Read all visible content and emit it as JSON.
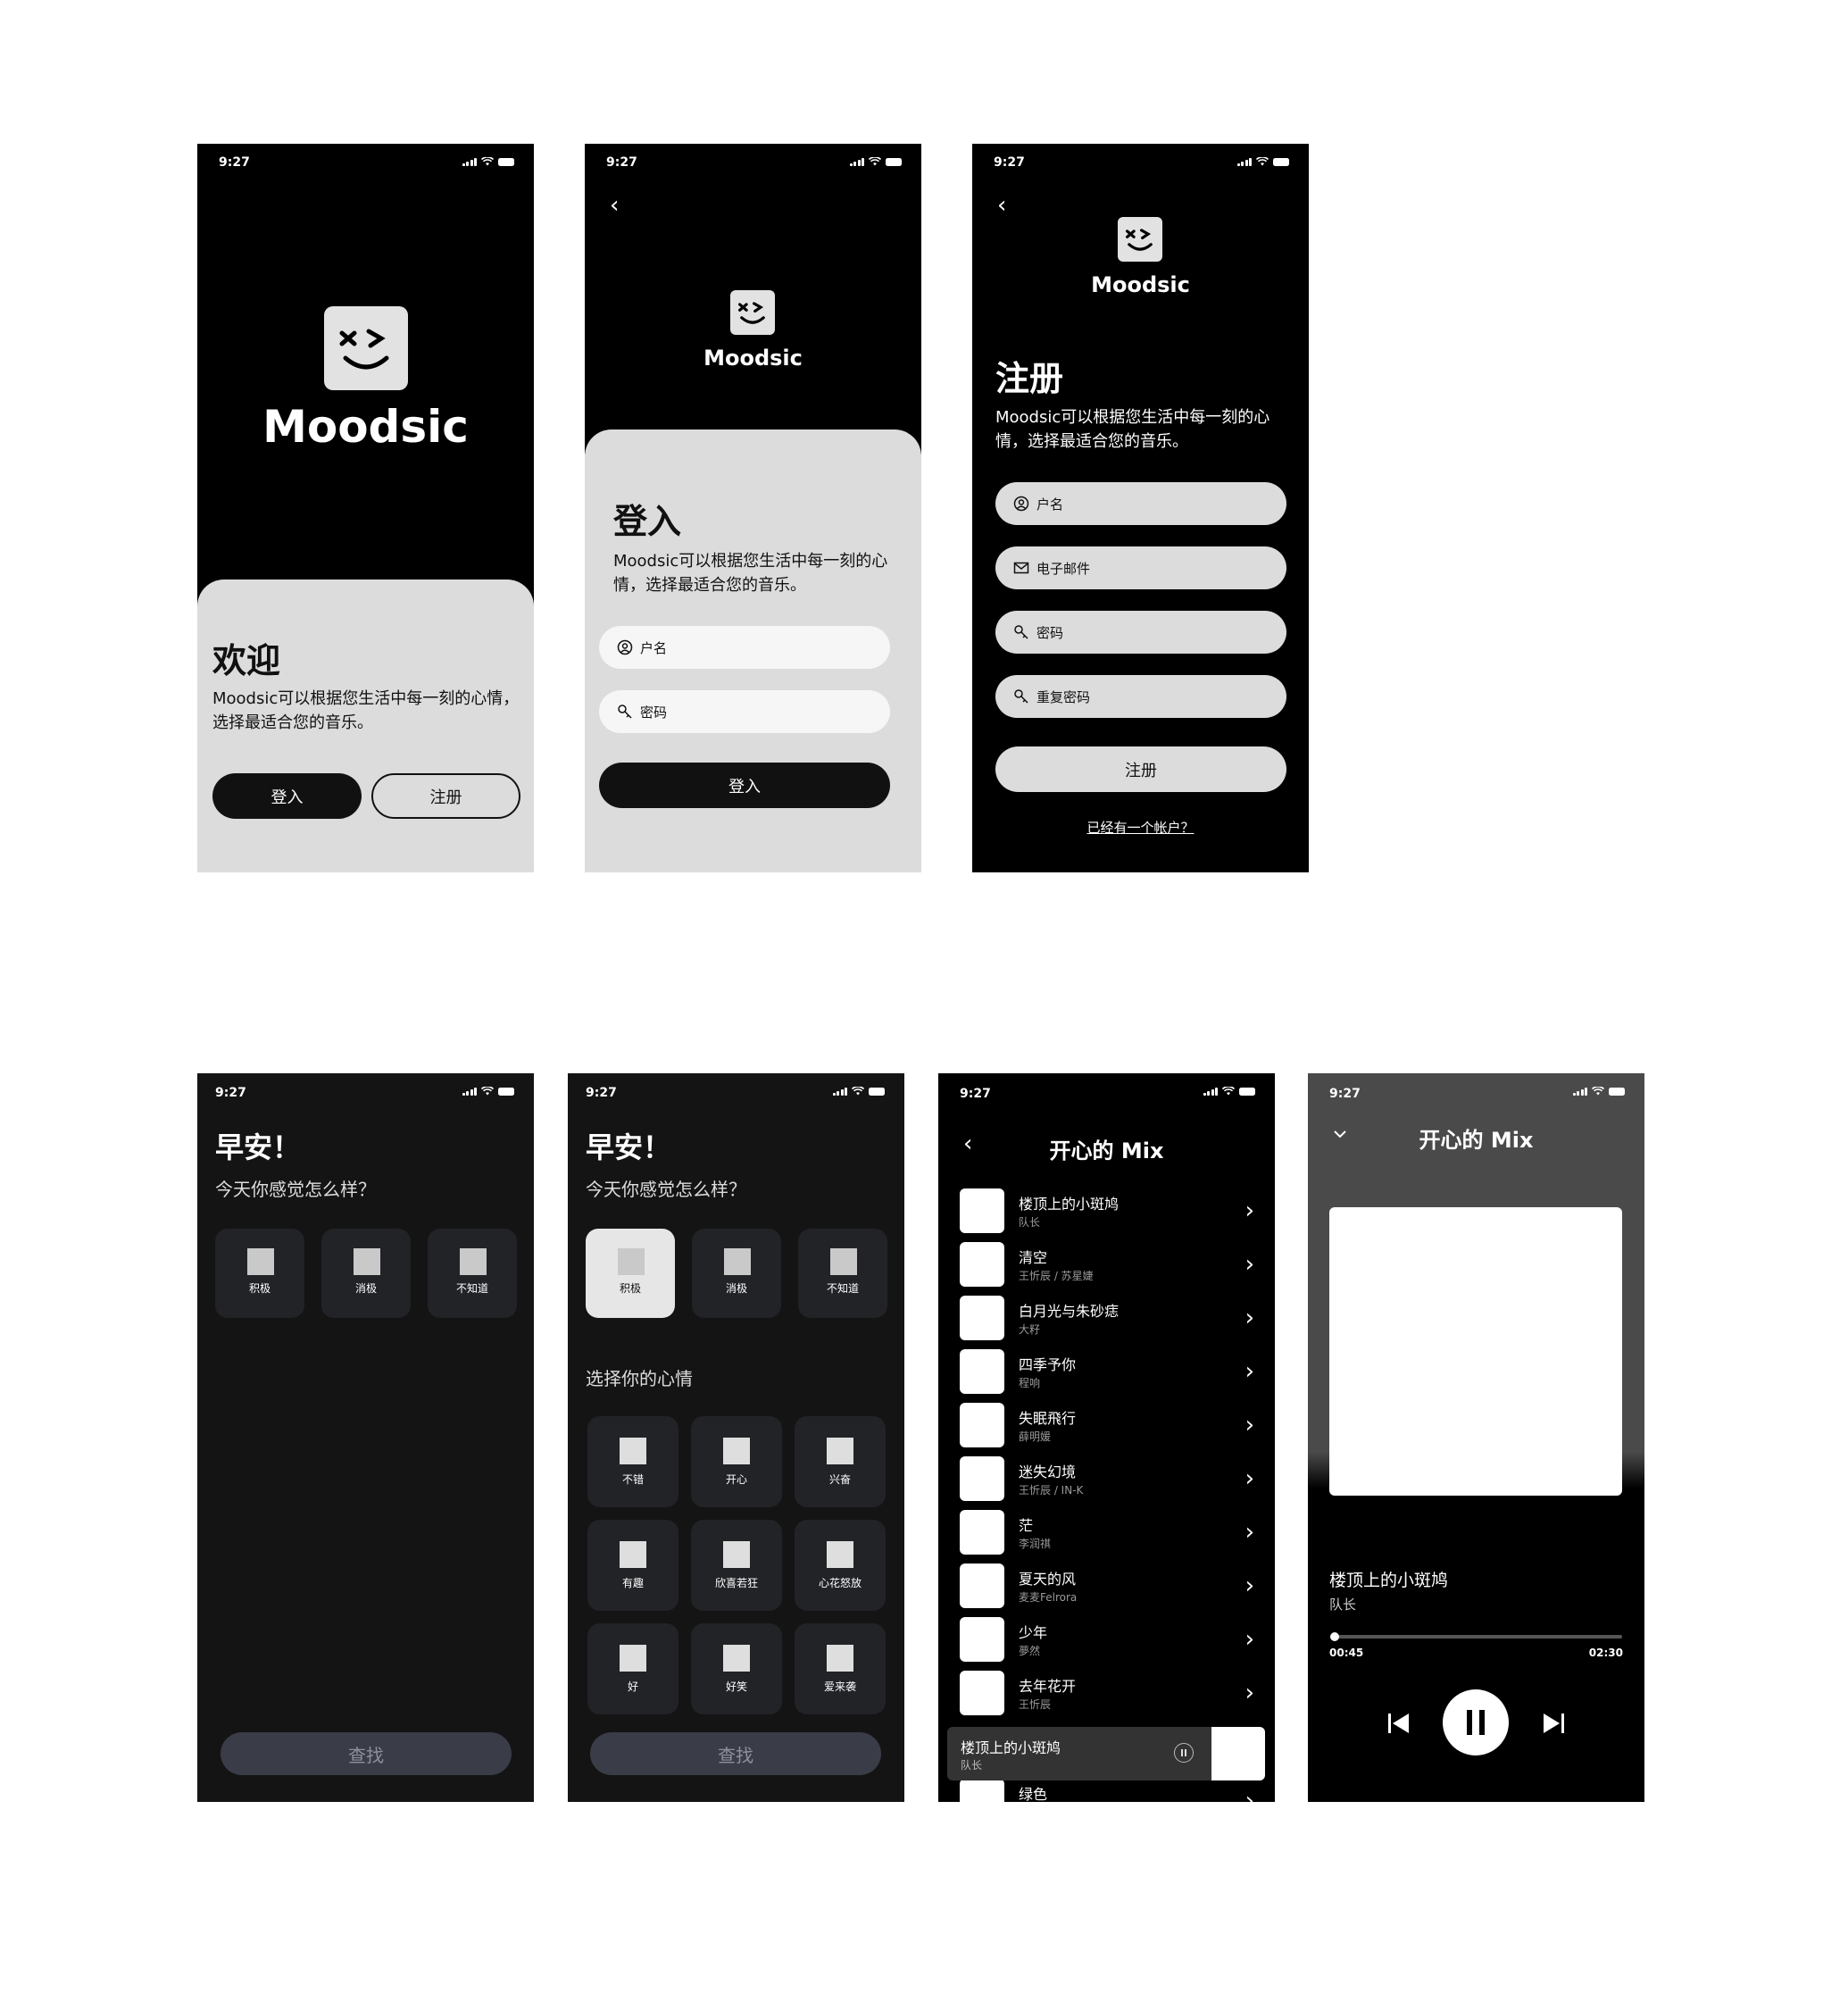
{
  "status": {
    "time": "9:27"
  },
  "app": {
    "brand": "Moodsic"
  },
  "welcome": {
    "title": "欢迎",
    "description": "Moodsic可以根据您生活中每一刻的心情，选择最适合您的音乐。",
    "login_button": "登入",
    "register_button": "注册"
  },
  "login": {
    "title": "登入",
    "description": "Moodsic可以根据您生活中每一刻的心情，选择最适合您的音乐。",
    "username_placeholder": "户名",
    "password_placeholder": "密码",
    "submit": "登入"
  },
  "register": {
    "title": "注册",
    "description": "Moodsic可以根据您生活中每一刻的心情，选择最适合您的音乐。",
    "username_placeholder": "户名",
    "email_placeholder": "电子邮件",
    "password_placeholder": "密码",
    "repeat_password_placeholder": "重复密码",
    "submit": "注册",
    "have_account": "已经有一个帐户？"
  },
  "mood1": {
    "greeting": "早安！",
    "question": "今天你感觉怎么样？",
    "categories": [
      "积极",
      "消极",
      "不知道"
    ],
    "find_button": "查找"
  },
  "mood2": {
    "greeting": "早安！",
    "question": "今天你感觉怎么样？",
    "categories": [
      "积极",
      "消极",
      "不知道"
    ],
    "choose_label": "选择你的心情",
    "moods": [
      "不错",
      "开心",
      "兴奋",
      "有趣",
      "欣喜若狂",
      "心花怒放",
      "好",
      "好笑",
      "爱来袭"
    ],
    "find_button": "查找"
  },
  "playlist": {
    "title": "开心的 Mix",
    "songs": [
      {
        "title": "楼顶上的小斑鸠",
        "artist": "队长"
      },
      {
        "title": "清空",
        "artist": "王忻辰 / 苏星婕"
      },
      {
        "title": "白月光与朱砂痣",
        "artist": "大籽"
      },
      {
        "title": "四季予你",
        "artist": "程响"
      },
      {
        "title": "失眠飛行",
        "artist": "薛明媛"
      },
      {
        "title": "迷失幻境",
        "artist": "王忻辰 / IN-K"
      },
      {
        "title": "茫",
        "artist": "李润祺"
      },
      {
        "title": "夏天的风",
        "artist": "麦麦Felrora"
      },
      {
        "title": "少年",
        "artist": "夢然"
      },
      {
        "title": "去年花开",
        "artist": "王忻辰"
      },
      {
        "title": "绿色",
        "artist": ""
      }
    ],
    "mini_player": {
      "title": "楼顶上的小斑鸠",
      "artist": "队长"
    }
  },
  "player": {
    "title": "开心的 Mix",
    "song_title": "楼顶上的小斑鸠",
    "artist": "队长",
    "current_time": "00:45",
    "total_time": "02:30",
    "progress": 0.02
  }
}
